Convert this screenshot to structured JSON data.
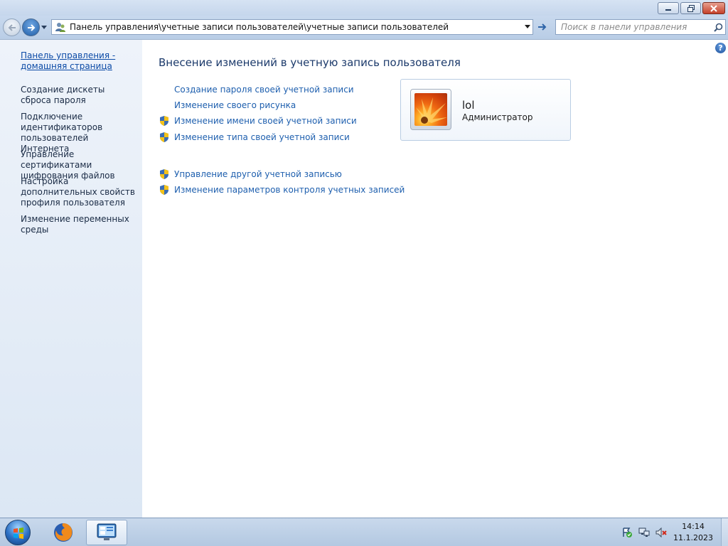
{
  "window": {
    "minimize_glyph": "—",
    "restore_glyph": "❐",
    "close_glyph": "✕"
  },
  "navigation": {
    "address_path": "Панель управления\\учетные записи пользователей\\учетные записи пользователей",
    "search_placeholder": "Поиск в панели управления"
  },
  "sidebar": {
    "home_link": "Панель управления - домашняя страница",
    "tasks": [
      "Создание дискеты сброса пароля",
      "Подключение идентификаторов пользователей Интернета",
      "Управление сертификатами шифрования файлов",
      "Настройка дополнительных свойств профиля пользователя",
      "Изменение переменных среды"
    ]
  },
  "main": {
    "help_glyph": "?",
    "heading": "Внесение изменений в учетную запись пользователя",
    "links": [
      "Создание пароля своей учетной записи",
      "Изменение своего рисунка",
      "Изменение имени своей учетной записи",
      "Изменение типа своей учетной записи"
    ],
    "other_links": [
      "Управление другой учетной записью",
      "Изменение параметров контроля учетных записей"
    ],
    "account": {
      "name": "lol",
      "role": "Администратор"
    }
  },
  "taskbar": {
    "apps": [
      "firefox-icon",
      "control-panel-icon"
    ],
    "tray_icons": [
      "action-center-icon",
      "network-icon",
      "volume-muted-icon"
    ],
    "time": "14:14",
    "date": "11.1.2023"
  },
  "colors": {
    "link": "#1e5fae",
    "heading": "#1c3a6b",
    "sidebar_bg": "#e4ecf7",
    "taskbar": "#c0d2e8"
  }
}
